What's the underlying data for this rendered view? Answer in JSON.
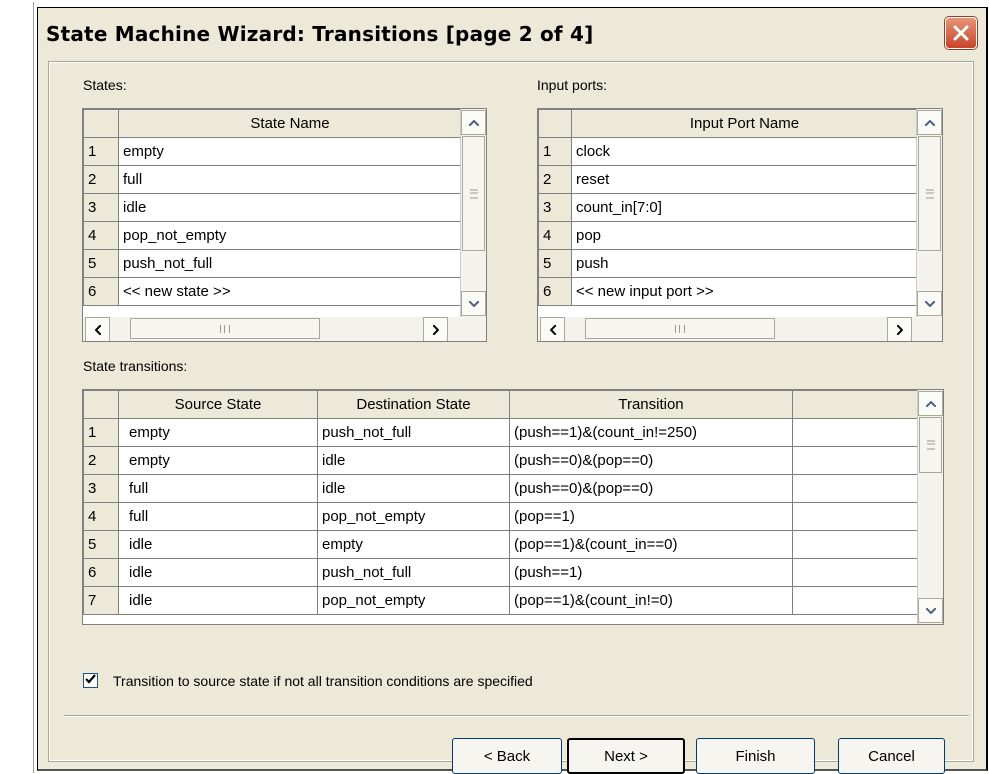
{
  "window": {
    "title": "State Machine Wizard: Transitions [page 2 of 4]"
  },
  "icons": {
    "close": "close-icon",
    "up": "scroll-up-arrow-icon",
    "down": "scroll-down-arrow-icon",
    "left": "scroll-left-arrow-icon",
    "right": "scroll-right-arrow-icon",
    "check": "checkmark-icon"
  },
  "states": {
    "label": "States:",
    "header": "State Name",
    "rows": [
      {
        "n": "1",
        "v": "empty"
      },
      {
        "n": "2",
        "v": "full"
      },
      {
        "n": "3",
        "v": "idle"
      },
      {
        "n": "4",
        "v": "pop_not_empty"
      },
      {
        "n": "5",
        "v": "push_not_full"
      },
      {
        "n": "6",
        "v": "<< new state >>"
      }
    ]
  },
  "inputs": {
    "label": "Input ports:",
    "header": "Input Port Name",
    "rows": [
      {
        "n": "1",
        "v": "clock"
      },
      {
        "n": "2",
        "v": "reset"
      },
      {
        "n": "3",
        "v": "count_in[7:0]"
      },
      {
        "n": "4",
        "v": "pop"
      },
      {
        "n": "5",
        "v": "push"
      },
      {
        "n": "6",
        "v": "<< new input port >>"
      }
    ]
  },
  "transitions": {
    "label": "State transitions:",
    "headers": [
      "Source State",
      "Destination State",
      "Transition"
    ],
    "rows": [
      {
        "n": "1",
        "src": "empty",
        "dst": "push_not_full",
        "cond": "(push==1)&(count_in!=250)"
      },
      {
        "n": "2",
        "src": "empty",
        "dst": "idle",
        "cond": "(push==0)&(pop==0)"
      },
      {
        "n": "3",
        "src": "full",
        "dst": "idle",
        "cond": "(push==0)&(pop==0)"
      },
      {
        "n": "4",
        "src": "full",
        "dst": "pop_not_empty",
        "cond": "(pop==1)"
      },
      {
        "n": "5",
        "src": "idle",
        "dst": "empty",
        "cond": "(pop==1)&(count_in==0)"
      },
      {
        "n": "6",
        "src": "idle",
        "dst": "push_not_full",
        "cond": "(push==1)"
      },
      {
        "n": "7",
        "src": "idle",
        "dst": "pop_not_empty",
        "cond": "(pop==1)&(count_in!=0)"
      }
    ]
  },
  "options": {
    "transition_to_source": {
      "label": "Transition to source state if not all transition conditions are specified",
      "checked": true
    }
  },
  "buttons": {
    "back": "< Back",
    "next": "Next >",
    "finish": "Finish",
    "cancel": "Cancel"
  }
}
